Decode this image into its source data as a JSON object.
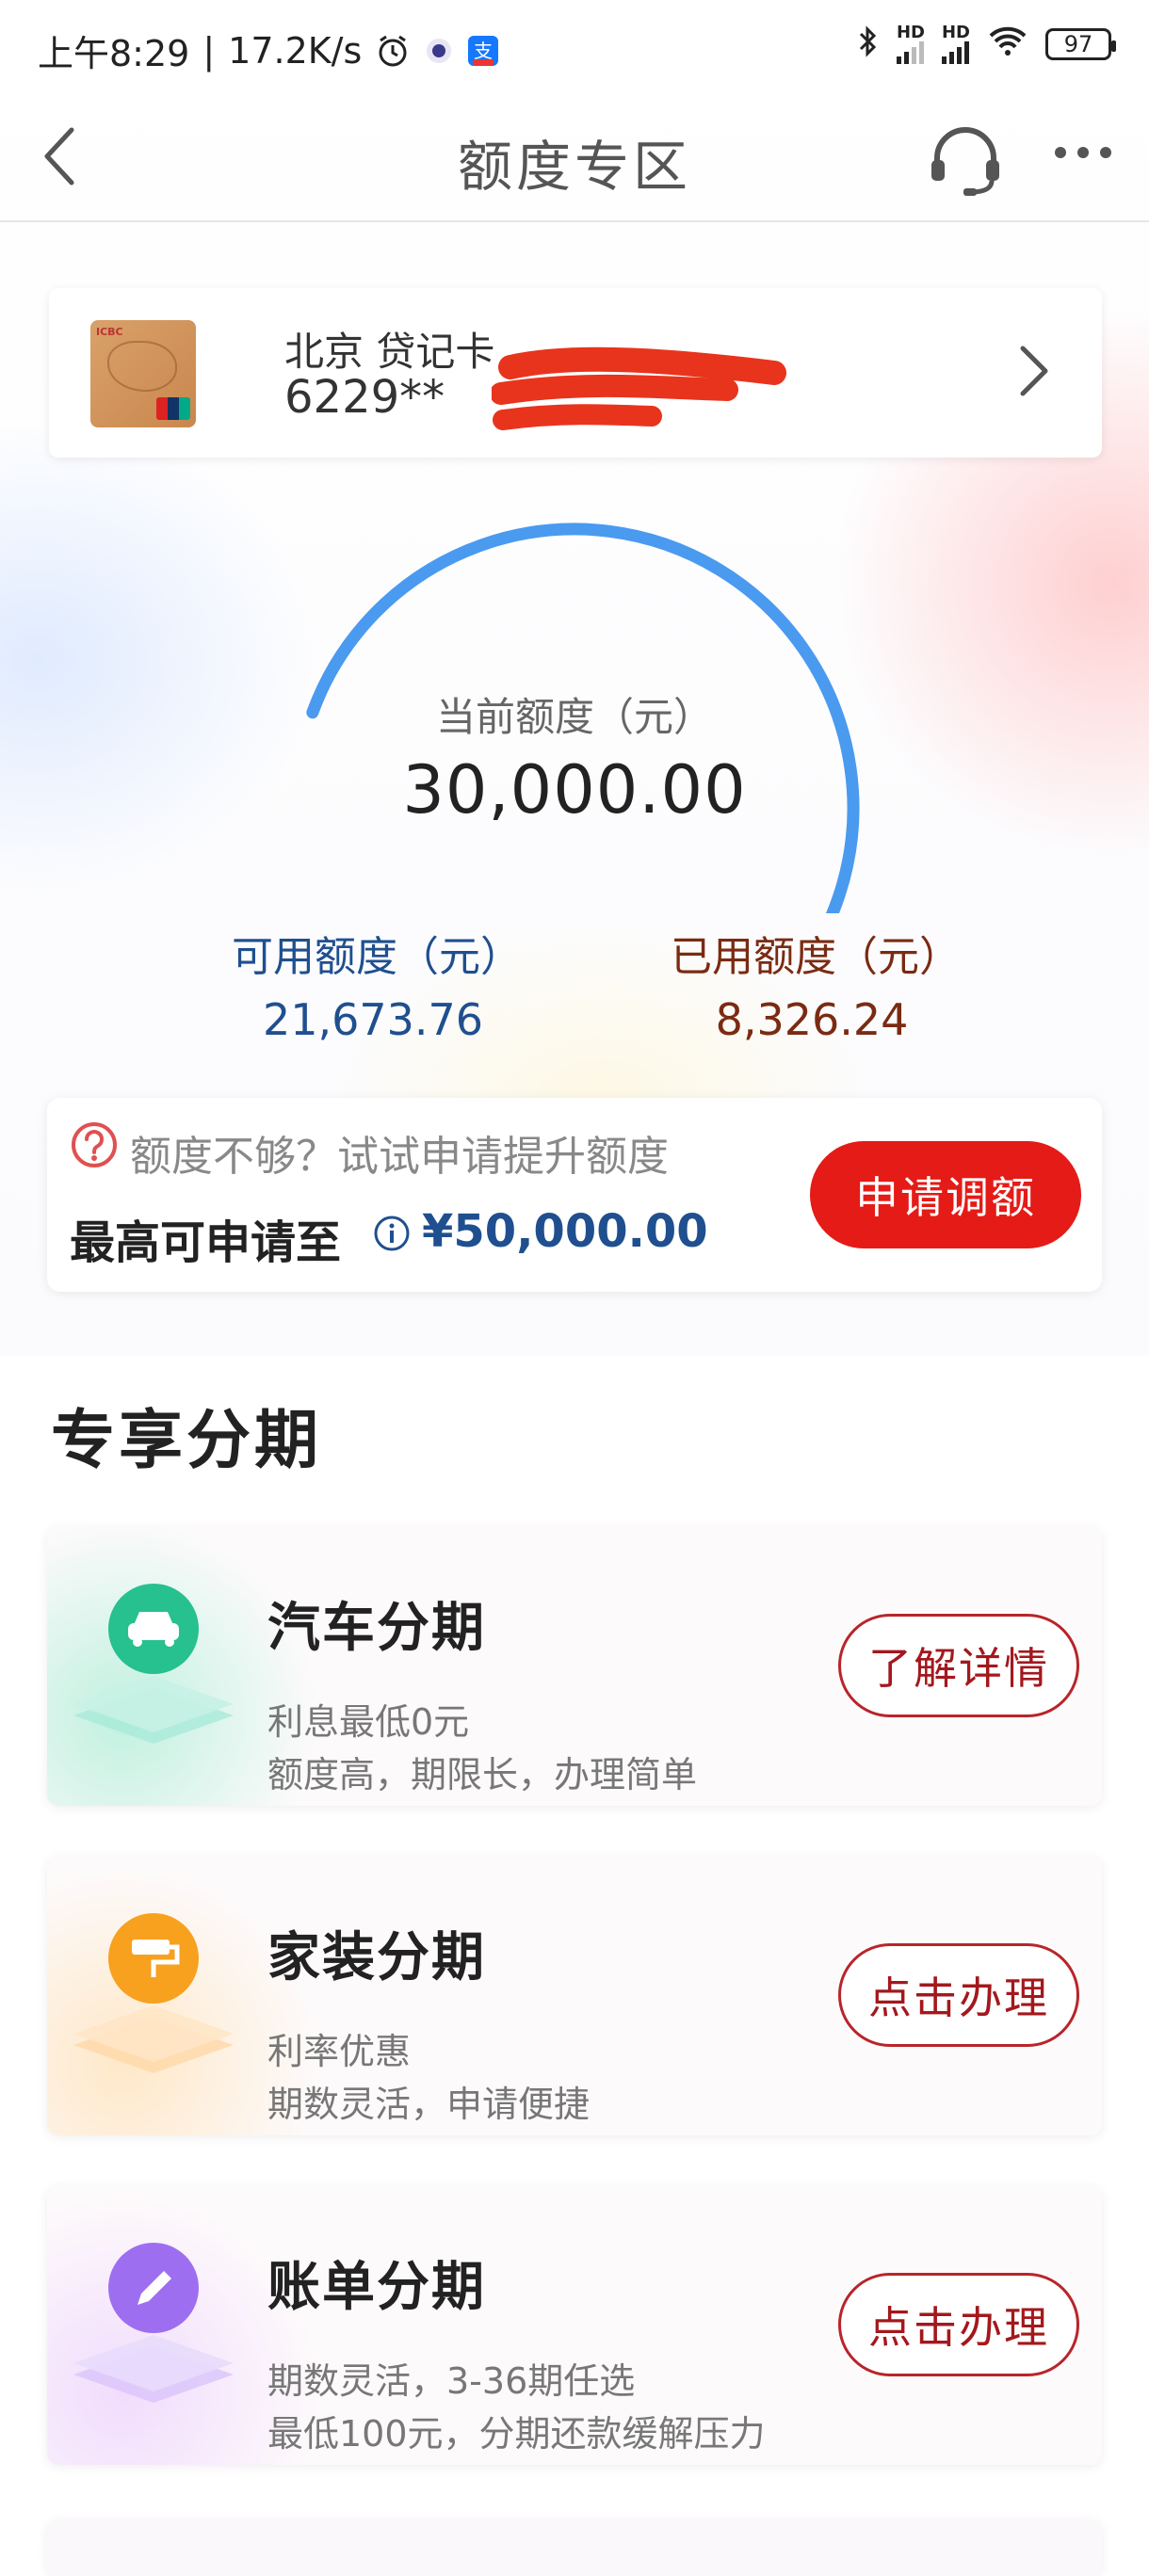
{
  "status_bar": {
    "time": "上午8:29",
    "speed": "17.2K/s",
    "hd1": "HD",
    "hd2": "HD",
    "battery": "97"
  },
  "header": {
    "title": "额度专区",
    "back_icon": "chevron-left-icon",
    "service_icon": "headset-icon",
    "more_icon": "more-dots-icon"
  },
  "card": {
    "name": "北京 贷记卡",
    "number": "6229**"
  },
  "gauge": {
    "label": "当前额度（元）",
    "value": "30,000.00",
    "used_fraction": 0.2775,
    "available_color": "#4a9af0",
    "used_color": "#f0531e"
  },
  "available": {
    "label": "可用额度（元）",
    "value": "21,673.76"
  },
  "used": {
    "label": "已用额度（元）",
    "value": "8,326.24"
  },
  "raise": {
    "hint": "额度不够？试试申请提升额度",
    "max_label": "最高可申请至",
    "max_value": "¥50,000.00",
    "button": "申请调额"
  },
  "section": {
    "title": "专享分期"
  },
  "plans": [
    {
      "title": "汽车分期",
      "sub1": "利息最低0元",
      "sub2": "额度高，期限长，办理简单",
      "button": "了解详情",
      "icon": "car-icon",
      "accent": "#2fc79a"
    },
    {
      "title": "家装分期",
      "sub1": "利率优惠",
      "sub2": "期数灵活，申请便捷",
      "button": "点击办理",
      "icon": "paint-roller-icon",
      "accent": "#f59a1b"
    },
    {
      "title": "账单分期",
      "sub1": "期数灵活，3-36期任选",
      "sub2": "最低100元，分期还款缓解压力",
      "button": "点击办理",
      "icon": "pencil-icon",
      "accent": "#9b6ef0"
    }
  ]
}
